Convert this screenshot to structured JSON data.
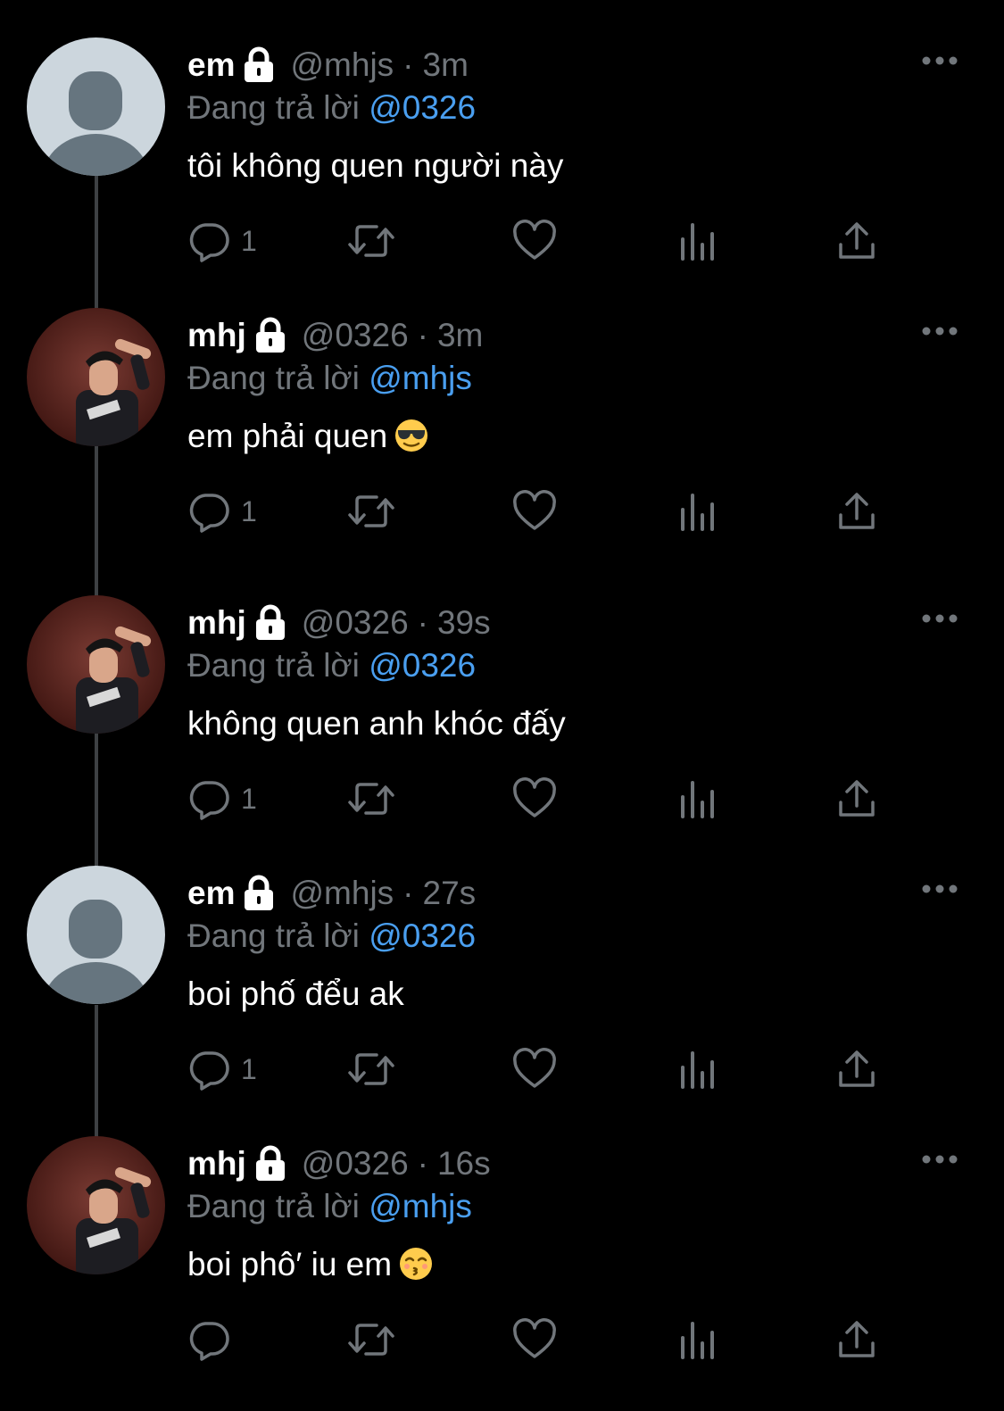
{
  "tweets": [
    {
      "display_name": "em",
      "handle": "@mhjs",
      "separator": "·",
      "time": "3m",
      "reply_prefix": "Đang trả lời",
      "reply_to": "@0326",
      "text": "tôi không quen người này",
      "emoji": "",
      "avatar": "default",
      "reply_count": "1"
    },
    {
      "display_name": "mhj",
      "handle": "@0326",
      "separator": "·",
      "time": "3m",
      "reply_prefix": "Đang trả lời",
      "reply_to": "@mhjs",
      "text": "em phải quen",
      "emoji": "smiling-face-with-sunglasses",
      "avatar": "photo",
      "reply_count": "1"
    },
    {
      "display_name": "mhj",
      "handle": "@0326",
      "separator": "·",
      "time": "39s",
      "reply_prefix": "Đang trả lời",
      "reply_to": "@0326",
      "text": "không quen anh khóc đấy",
      "emoji": "",
      "avatar": "photo",
      "reply_count": "1"
    },
    {
      "display_name": "em",
      "handle": "@mhjs",
      "separator": "·",
      "time": "27s",
      "reply_prefix": "Đang trả lời",
      "reply_to": "@0326",
      "text": "boi phố đểu ak",
      "emoji": "",
      "avatar": "default",
      "reply_count": "1"
    },
    {
      "display_name": "mhj",
      "handle": "@0326",
      "separator": "·",
      "time": "16s",
      "reply_prefix": "Đang trả lời",
      "reply_to": "@mhjs",
      "text": "boi phô′ iu em",
      "emoji": "kissing-face-with-smiling-eyes",
      "avatar": "photo",
      "reply_count": ""
    }
  ],
  "icons": {
    "lock": "lock-icon",
    "more": "more-icon",
    "reply": "reply-icon",
    "retweet": "retweet-icon",
    "like": "like-icon",
    "views": "views-icon",
    "share": "share-icon"
  },
  "colors": {
    "background": "#000000",
    "text": "#ffffff",
    "secondary": "#71767b",
    "mention": "#4a9ff0",
    "thread_line": "#3e4144"
  }
}
